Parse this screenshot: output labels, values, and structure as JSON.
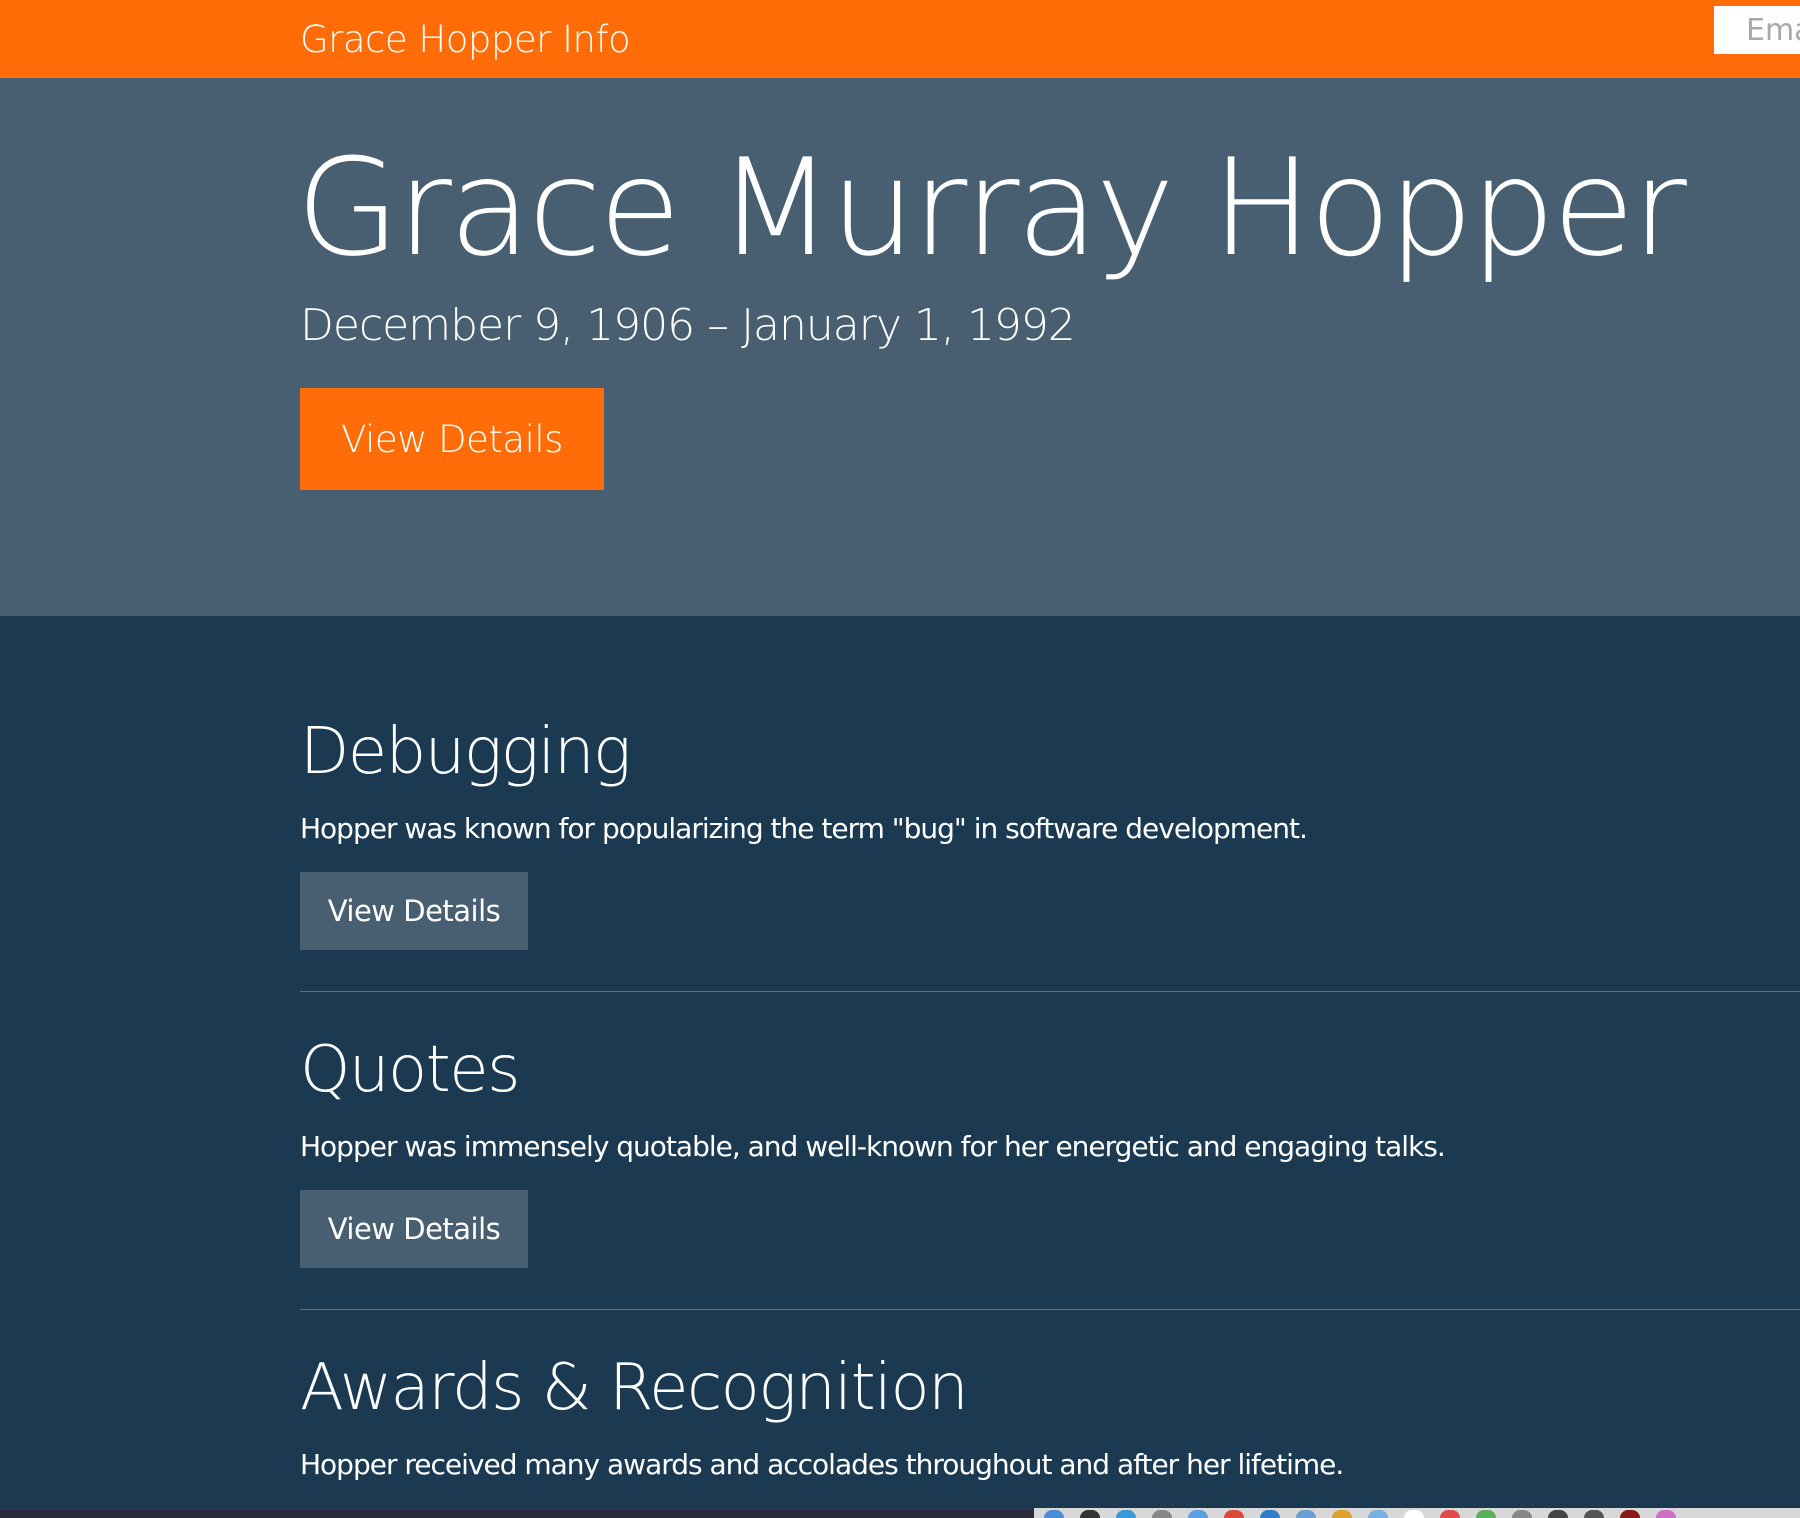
{
  "navbar": {
    "brand": "Grace Hopper Info",
    "email_placeholder": "Ema"
  },
  "hero": {
    "title": "Grace Murray Hopper",
    "dates": "December 9, 1906 – January 1, 1992",
    "button_label": "View Details"
  },
  "sections": [
    {
      "title": "Debugging",
      "description": "Hopper was known for popularizing the term \"bug\" in software development.",
      "button_label": "View Details"
    },
    {
      "title": "Quotes",
      "description": "Hopper was immensely quotable, and well-known for her energetic and engaging talks.",
      "button_label": "View Details"
    },
    {
      "title": "Awards & Recognition",
      "description": "Hopper received many awards and accolades throughout and after her lifetime."
    }
  ],
  "colors": {
    "accent": "#ff6c08",
    "hero_bg": "#485f71",
    "content_bg": "#1b3a52",
    "text": "#ffffff"
  }
}
